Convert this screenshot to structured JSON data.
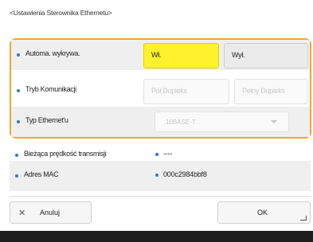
{
  "title": "<Ustawienia Sterownika Ethernetu>",
  "rows": {
    "auto_detect": {
      "label": "Automa. wykrywa.",
      "on": "Wł.",
      "off": "Wył.",
      "selected": "on"
    },
    "comm_mode": {
      "label": "Tryb Komunikacji",
      "half": "Pół Dupleks",
      "full": "Pełny Dupleks"
    },
    "ethernet_type": {
      "label": "Typ Ethernet'u",
      "value": "10BASE-T"
    },
    "speed": {
      "label": "Bieżąca prędkość transmisji",
      "value": "----"
    },
    "mac": {
      "label": "Adres MAC",
      "value": "000c2984bbf8"
    }
  },
  "footer": {
    "cancel": "Anuluj",
    "ok": "OK"
  },
  "colors": {
    "highlight_border": "#f0a630",
    "selected": "#fff12b",
    "bullet": "#2a7cc7"
  }
}
